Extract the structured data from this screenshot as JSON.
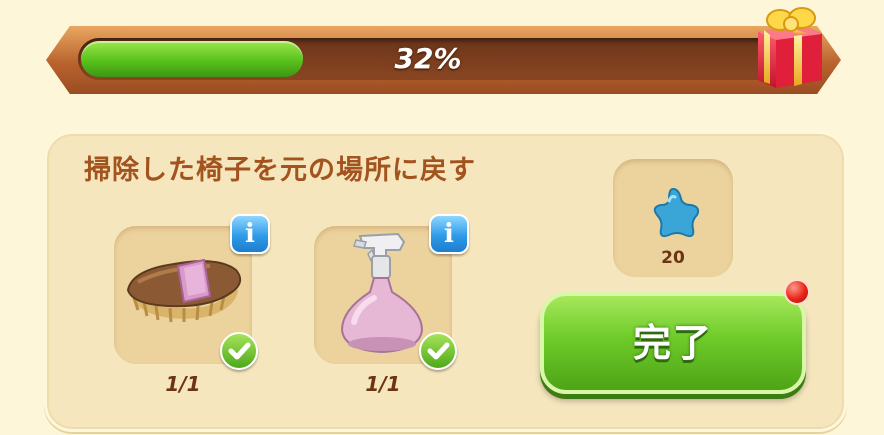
{
  "progress": {
    "value": 0.32,
    "label": "32%",
    "fill_color": "#59c11b",
    "reward_icon": "gift-box-icon"
  },
  "task": {
    "title": "掃除した椅子を元の場所に戻す",
    "items": [
      {
        "icon": "scrub-brush-icon",
        "count": "1/1",
        "complete": true,
        "info_icon": "info-icon"
      },
      {
        "icon": "spray-bottle-icon",
        "count": "1/1",
        "complete": true,
        "info_icon": "info-icon"
      }
    ],
    "reward": {
      "icon": "blue-star-icon",
      "amount": "20"
    },
    "complete_button": {
      "label": "完了",
      "color": "#6ecb2a"
    },
    "notification_color": "#e8241a"
  }
}
